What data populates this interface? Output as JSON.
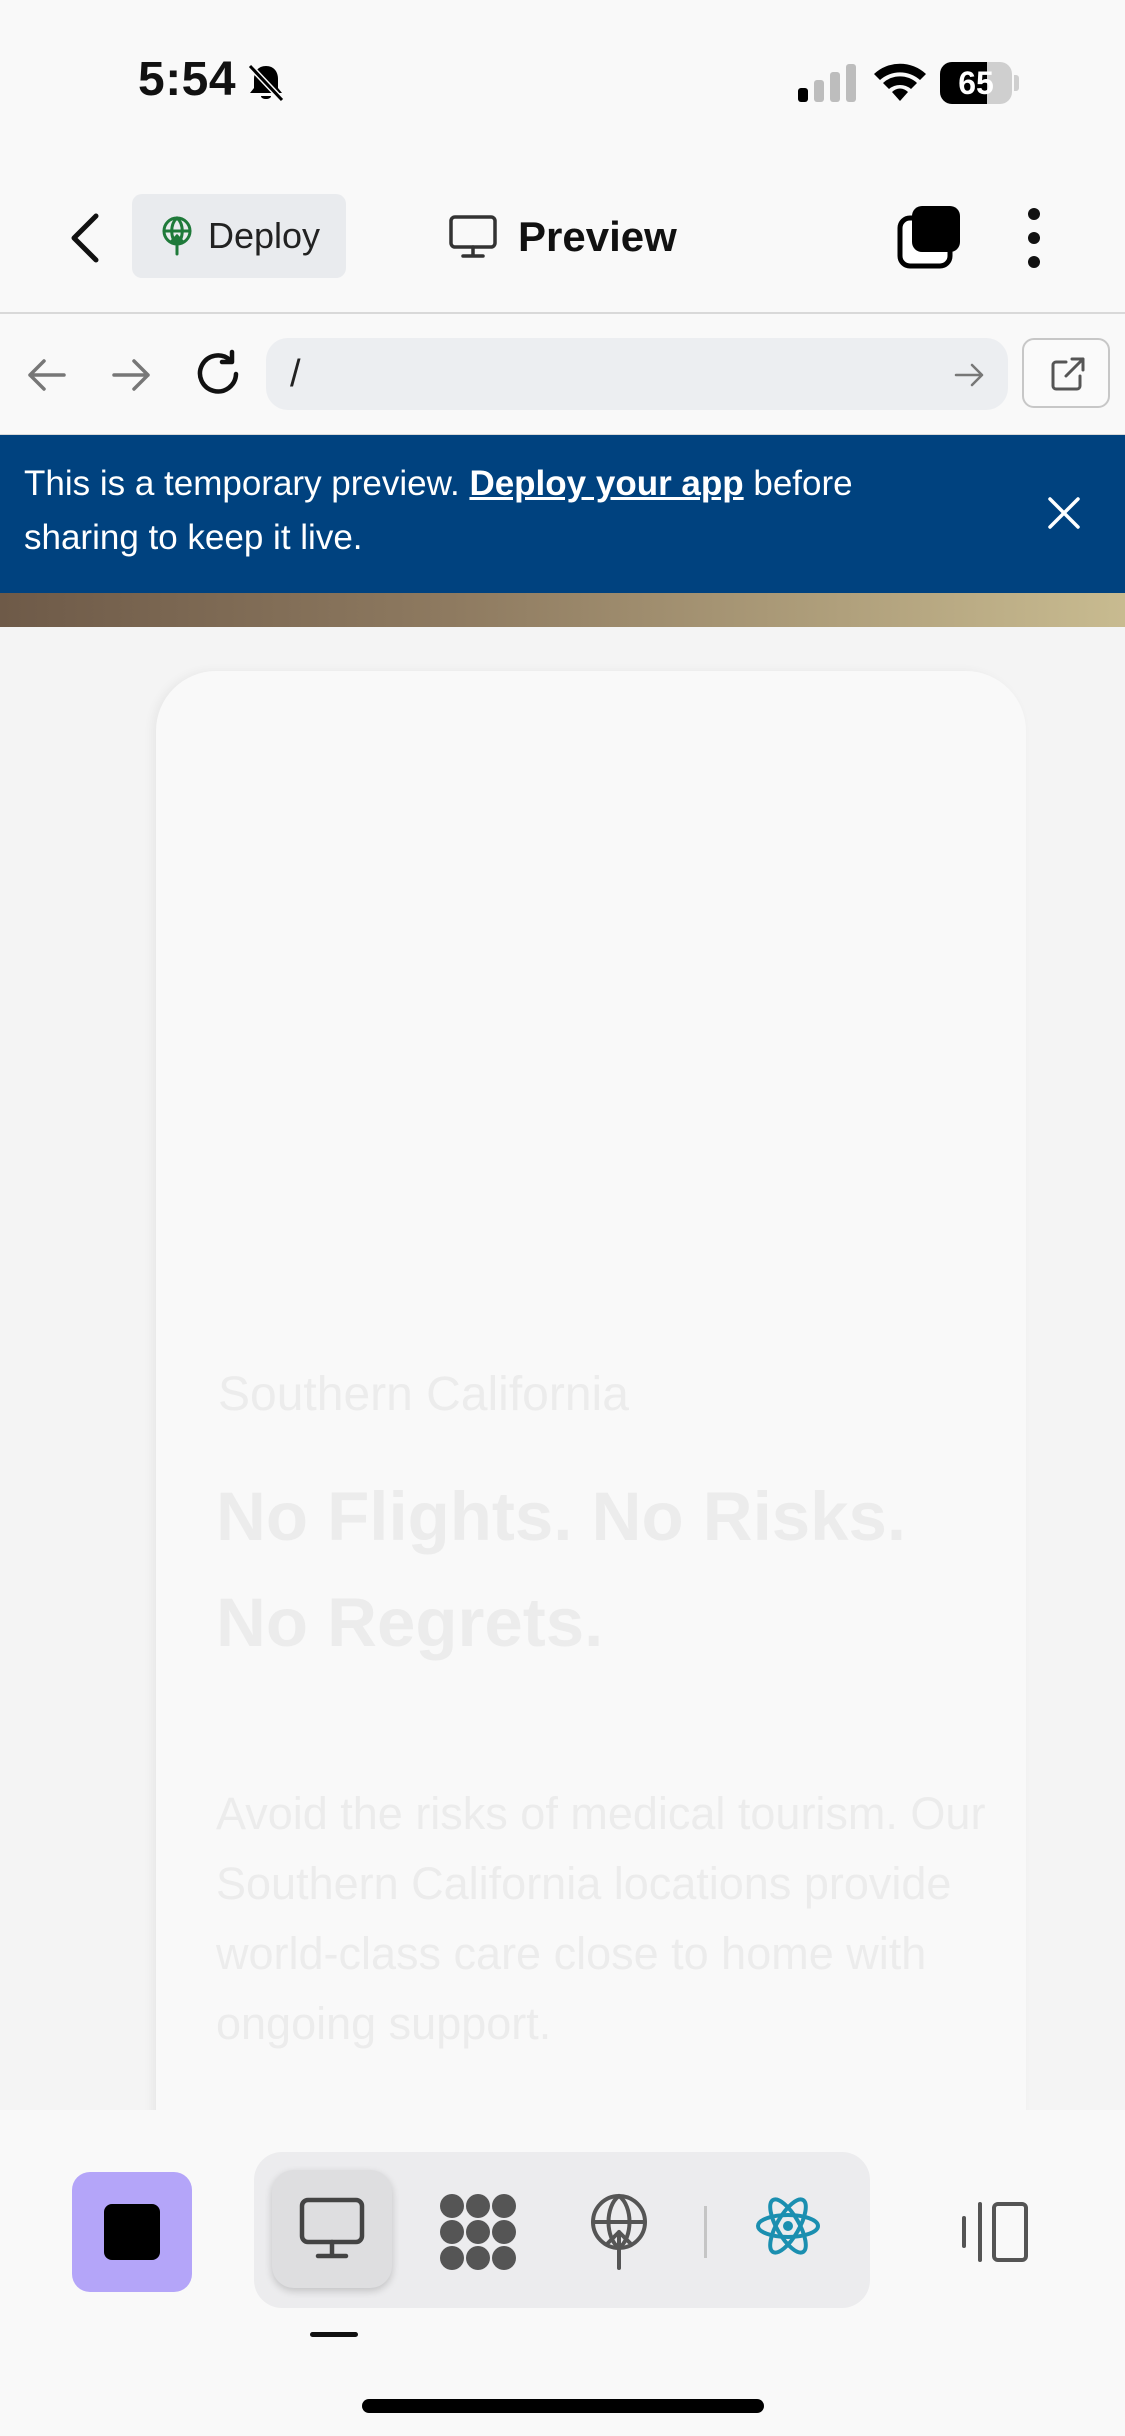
{
  "status_bar": {
    "time": "5:54",
    "battery_level": "65",
    "battery_fraction": 0.65
  },
  "header": {
    "deploy_label": "Deploy",
    "preview_label": "Preview"
  },
  "url_bar": {
    "address": "/"
  },
  "banner": {
    "text_before": "This is a temporary preview. ",
    "link_text": "Deploy your app",
    "text_after": " before sharing to keep it live."
  },
  "hero": {
    "kicker": "Southern California",
    "title_line1": "No Flights. No Risks.",
    "title_line2": "No Regrets.",
    "body": "Avoid the risks of medical tourism. Our Southern California locations provide world-class care close to home with ongoing support."
  },
  "colors": {
    "banner_bg": "#00427f",
    "stop_button_bg": "#b4a5f9",
    "react_icon": "#1b8fb0",
    "deploy_icon": "#1f7a3a"
  },
  "icons": [
    "bell-slash-icon",
    "signal-icon",
    "wifi-icon",
    "battery-icon",
    "chevron-left-icon",
    "deploy-icon",
    "monitor-icon",
    "tabs-icon",
    "more-vertical-icon",
    "arrow-left-icon",
    "arrow-right-icon",
    "reload-icon",
    "go-arrow-icon",
    "external-link-icon",
    "close-icon",
    "stop-icon",
    "desktop-icon",
    "nodes-icon",
    "react-icon",
    "layout-toggle-icon"
  ]
}
